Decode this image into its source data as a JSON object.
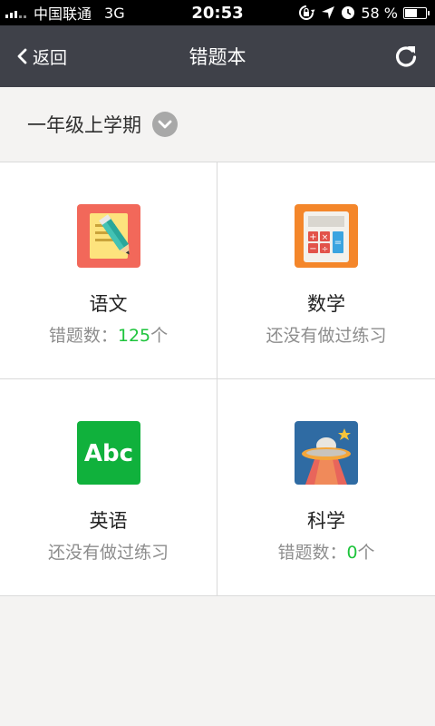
{
  "status_bar": {
    "carrier": "中国联通",
    "network": "3G",
    "time": "20:53",
    "battery": "58 %"
  },
  "nav": {
    "back_label": "返回",
    "title": "错题本"
  },
  "grade": {
    "label": "一年级上学期"
  },
  "colors": {
    "nav_bg": "#3f4149",
    "count_green": "#1ec43c"
  },
  "subjects": [
    {
      "name": "语文",
      "status_prefix": "错题数：",
      "count": "125",
      "status_suffix": "个",
      "icon": "pencil-notebook-icon"
    },
    {
      "name": "数学",
      "status": "还没有做过练习",
      "icon": "calculator-icon"
    },
    {
      "name": "英语",
      "status": "还没有做过练习",
      "icon": "abc-icon"
    },
    {
      "name": "科学",
      "status_prefix": "错题数：",
      "count": "0",
      "status_suffix": "个",
      "icon": "ufo-icon"
    }
  ]
}
